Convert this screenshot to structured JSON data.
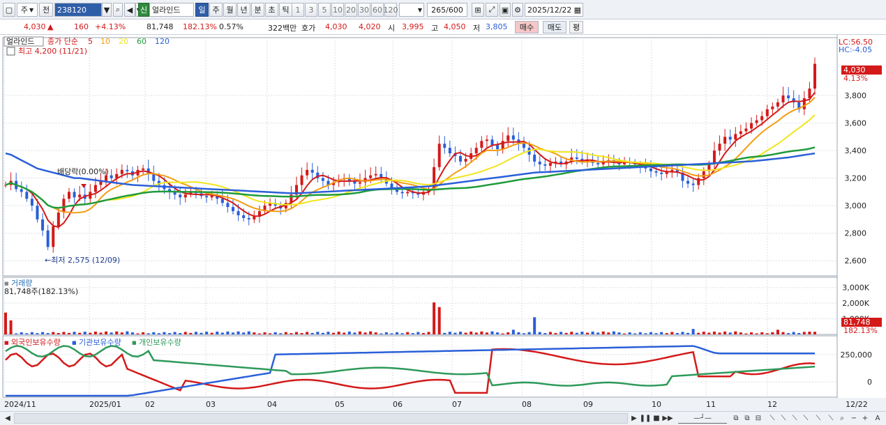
{
  "toolbar": {
    "market": "주",
    "prev": "전",
    "code": "238120",
    "badge": "신",
    "name": "얼라인드",
    "periods": [
      "일",
      "주",
      "월",
      "년",
      "분",
      "초",
      "틱"
    ],
    "active_period": "일",
    "intervals": [
      "1",
      "3",
      "5",
      "10",
      "20",
      "30",
      "60",
      "120"
    ],
    "count": "265",
    "count_total": "/600",
    "date": "2025/12/22"
  },
  "quote": {
    "price": "4,030",
    "change_arrow": "▲",
    "change": "160",
    "change_pct": "+4.13%",
    "volume": "81,748",
    "volume_pct": "182.13%",
    "turnover_pct": "0.57%",
    "amount": "322백만",
    "hoga_label": "호가",
    "ask": "4,030",
    "bid": "4,020",
    "open_label": "시",
    "open": "3,995",
    "high_label": "고",
    "high": "4,050",
    "low_label": "저",
    "low": "3,805",
    "buy_label": "매수",
    "sell_label": "매도",
    "eval_label": "평"
  },
  "price_panel": {
    "name_tag": "얼라인드",
    "ma_label": "종가 단순",
    "ma_periods": [
      "5",
      "10",
      "20",
      "60",
      "120"
    ],
    "ma_colors": [
      "#d41919",
      "#f39c12",
      "#f2e51c",
      "#1f9a3a",
      "#2a5fd8"
    ],
    "high_note": "최고 4,200 (11/21)",
    "low_note": "←최저 2,575 (12/09)",
    "dividend_note": "배당락(0.00%)",
    "lc": "LC:56.50",
    "hc": "HC:-4.05",
    "last_price_tag": "4,030",
    "last_pct_tag": "4.13%",
    "y_ticks": [
      "3,800",
      "3,600",
      "3,400",
      "3,200",
      "3,000",
      "2,800",
      "2,600"
    ]
  },
  "volume_panel": {
    "title": "거래량",
    "value_note": "81,748주(182.13%)",
    "y_ticks": [
      "3,000K",
      "2,000K",
      "1,000K"
    ],
    "last_tag": "81,748",
    "last_pct": "182.13%"
  },
  "holder_panel": {
    "labels": [
      "외국인보유수량",
      "기관보유수량",
      "개인보유수량"
    ],
    "colors": [
      "#d41919",
      "#2a5fd8",
      "#2e9a5a"
    ],
    "y_ticks": [
      "250,000",
      "0"
    ]
  },
  "x_axis": {
    "labels": [
      "2024/11",
      "2025/01",
      "02",
      "03",
      "04",
      "05",
      "06",
      "07",
      "08",
      "09",
      "10",
      "11",
      "12"
    ],
    "right_label": "12/22"
  },
  "chart_data": {
    "type": "candlestick",
    "y_range": [
      2500,
      4200
    ],
    "close_series": [
      3150,
      3180,
      3120,
      3100,
      3050,
      3000,
      2900,
      2820,
      2700,
      2850,
      2950,
      3050,
      3100,
      3060,
      3080,
      3050,
      3100,
      3150,
      3180,
      3220,
      3200,
      3230,
      3260,
      3250,
      3220,
      3260,
      3270,
      3230,
      3180,
      3150,
      3120,
      3100,
      3080,
      3060,
      3080,
      3100,
      3090,
      3070,
      3060,
      3080,
      3050,
      3020,
      2990,
      2960,
      2930,
      2910,
      2900,
      2920,
      2960,
      3000,
      3020,
      3000,
      2980,
      3020,
      3080,
      3150,
      3220,
      3260,
      3240,
      3200,
      3180,
      3150,
      3170,
      3190,
      3200,
      3180,
      3160,
      3170,
      3200,
      3220,
      3230,
      3200,
      3160,
      3120,
      3100,
      3090,
      3100,
      3090,
      3080,
      3100,
      3120,
      3280,
      3450,
      3420,
      3380,
      3360,
      3320,
      3340,
      3380,
      3420,
      3470,
      3480,
      3440,
      3410,
      3470,
      3510,
      3480,
      3450,
      3420,
      3370,
      3320,
      3300,
      3290,
      3310,
      3320,
      3300,
      3320,
      3350,
      3340,
      3320,
      3330,
      3310,
      3300,
      3320,
      3330,
      3310,
      3300,
      3320,
      3310,
      3300,
      3280,
      3270,
      3250,
      3240,
      3230,
      3250,
      3260,
      3240,
      3180,
      3160,
      3150,
      3200,
      3250,
      3300,
      3400,
      3450,
      3500,
      3480,
      3520,
      3540,
      3560,
      3600,
      3620,
      3650,
      3700,
      3720,
      3750,
      3800,
      3780,
      3750,
      3700,
      3780,
      3850,
      4030
    ],
    "ma_series": [
      {
        "name": "5",
        "values": [
          3160,
          3150,
          3130,
          3100,
          3070,
          3010,
          2930,
          2850,
          2780,
          2760,
          2800,
          2870,
          2950,
          3000,
          3040,
          3060,
          3070,
          3080,
          3100,
          3140,
          3170,
          3190,
          3210,
          3220,
          3230,
          3240,
          3250,
          3240,
          3220,
          3200,
          3170,
          3140,
          3110,
          3090,
          3080,
          3080,
          3080,
          3080,
          3070,
          3070,
          3060,
          3040,
          3020,
          2990,
          2960,
          2930,
          2920,
          2920,
          2930,
          2960,
          2990,
          3000,
          3000,
          3000,
          3020,
          3060,
          3110,
          3170,
          3210,
          3220,
          3210,
          3190,
          3180,
          3180,
          3180,
          3180,
          3180,
          3180,
          3180,
          3190,
          3200,
          3200,
          3190,
          3170,
          3140,
          3110,
          3100,
          3100,
          3090,
          3090,
          3100,
          3150,
          3230,
          3300,
          3350,
          3380,
          3380,
          3370,
          3360,
          3370,
          3390,
          3410,
          3430,
          3440,
          3450,
          3460,
          3470,
          3470,
          3460,
          3440,
          3400,
          3360,
          3330,
          3310,
          3300,
          3300,
          3310,
          3320,
          3330,
          3330,
          3330,
          3330,
          3320,
          3320,
          3320,
          3320,
          3310,
          3310,
          3310,
          3310,
          3300,
          3290,
          3280,
          3260,
          3250,
          3250,
          3250,
          3250,
          3230,
          3210,
          3190,
          3180,
          3190,
          3220,
          3270,
          3330,
          3390,
          3440,
          3470,
          3500,
          3520,
          3550,
          3580,
          3600,
          3630,
          3660,
          3690,
          3720,
          3740,
          3750,
          3750,
          3760,
          3790,
          3860
        ]
      },
      {
        "name": "120",
        "values": [
          3380,
          3370,
          3350,
          3330,
          3310,
          3290,
          3270,
          3260,
          3250,
          3240,
          3230,
          3220,
          3210,
          3200,
          3200,
          3195,
          3190,
          3185,
          3180,
          3175,
          3170,
          3165,
          3160,
          3155,
          3150,
          3148,
          3146,
          3144,
          3142,
          3140,
          3138,
          3136,
          3134,
          3132,
          3130,
          3128,
          3126,
          3124,
          3122,
          3120,
          3118,
          3116,
          3114,
          3112,
          3110,
          3108,
          3106,
          3104,
          3102,
          3100,
          3098,
          3096,
          3094,
          3092,
          3090,
          3090,
          3092,
          3094,
          3096,
          3098,
          3100,
          3102,
          3104,
          3106,
          3108,
          3110,
          3112,
          3114,
          3116,
          3118,
          3120,
          3122,
          3124,
          3126,
          3128,
          3130,
          3132,
          3134,
          3136,
          3138,
          3140,
          3145,
          3150,
          3155,
          3160,
          3165,
          3170,
          3175,
          3180,
          3185,
          3190,
          3195,
          3200,
          3205,
          3210,
          3215,
          3220,
          3225,
          3230,
          3235,
          3240,
          3242,
          3244,
          3246,
          3248,
          3250,
          3252,
          3254,
          3256,
          3258,
          3260,
          3262,
          3264,
          3266,
          3268,
          3270,
          3272,
          3274,
          3276,
          3278,
          3280,
          3282,
          3284,
          3286,
          3288,
          3290,
          3292,
          3294,
          3296,
          3298,
          3300,
          3302,
          3304,
          3306,
          3308,
          3310,
          3312,
          3314,
          3316,
          3318,
          3320,
          3322,
          3326,
          3330,
          3334,
          3338,
          3342,
          3346,
          3350,
          3356,
          3362,
          3368,
          3374,
          3380
        ]
      }
    ]
  }
}
